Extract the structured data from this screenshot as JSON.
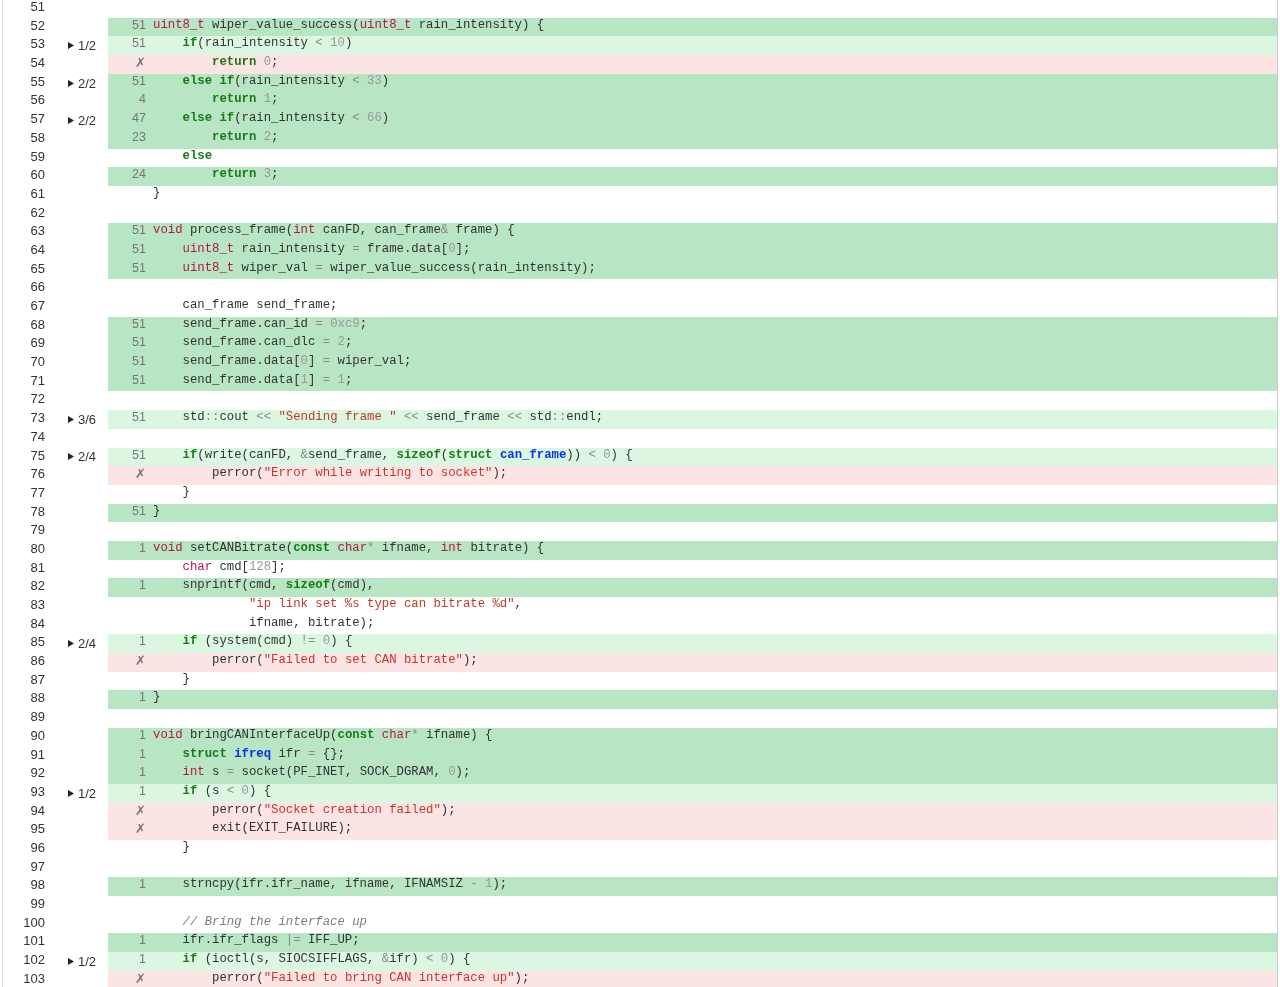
{
  "lines": [
    {
      "number": "51",
      "kind": "none"
    },
    {
      "number": "52",
      "kind": "covered",
      "count": "51",
      "code": [
        {
          "kind": "type",
          "text": "uint8_t"
        },
        {
          "kind": "plain",
          "text": " wiper_value_success("
        },
        {
          "kind": "type",
          "text": "uint8_t"
        },
        {
          "kind": "plain",
          "text": " rain_intensity) {"
        }
      ]
    },
    {
      "number": "53",
      "kind": "partial",
      "branch": "1/2",
      "count": "51",
      "code": [
        {
          "kind": "keyword",
          "text": "    if"
        },
        {
          "kind": "plain",
          "text": "(rain_intensity "
        },
        {
          "kind": "operator",
          "text": "<"
        },
        {
          "kind": "number",
          "text": " 10"
        },
        {
          "kind": "plain",
          "text": ")"
        }
      ]
    },
    {
      "number": "54",
      "kind": "uncovered",
      "count": "✗",
      "code": [
        {
          "kind": "keyword",
          "text": "        return"
        },
        {
          "kind": "number",
          "text": " 0"
        },
        {
          "kind": "plain",
          "text": ";"
        }
      ]
    },
    {
      "number": "55",
      "kind": "covered",
      "branch": "2/2",
      "count": "51",
      "code": [
        {
          "kind": "keyword",
          "text": "    else if"
        },
        {
          "kind": "plain",
          "text": "(rain_intensity "
        },
        {
          "kind": "operator",
          "text": "<"
        },
        {
          "kind": "number",
          "text": " 33"
        },
        {
          "kind": "plain",
          "text": ")"
        }
      ]
    },
    {
      "number": "56",
      "kind": "covered",
      "count": "4",
      "code": [
        {
          "kind": "keyword",
          "text": "        return"
        },
        {
          "kind": "number",
          "text": " 1"
        },
        {
          "kind": "plain",
          "text": ";"
        }
      ]
    },
    {
      "number": "57",
      "kind": "covered",
      "branch": "2/2",
      "count": "47",
      "code": [
        {
          "kind": "keyword",
          "text": "    else if"
        },
        {
          "kind": "plain",
          "text": "(rain_intensity "
        },
        {
          "kind": "operator",
          "text": "<"
        },
        {
          "kind": "number",
          "text": " 66"
        },
        {
          "kind": "plain",
          "text": ")"
        }
      ]
    },
    {
      "number": "58",
      "kind": "covered",
      "count": "23",
      "code": [
        {
          "kind": "keyword",
          "text": "        return"
        },
        {
          "kind": "number",
          "text": " 2"
        },
        {
          "kind": "plain",
          "text": ";"
        }
      ]
    },
    {
      "number": "59",
      "kind": "none",
      "code": [
        {
          "kind": "keyword",
          "text": "    else"
        }
      ]
    },
    {
      "number": "60",
      "kind": "covered",
      "count": "24",
      "code": [
        {
          "kind": "keyword",
          "text": "        return"
        },
        {
          "kind": "number",
          "text": " 3"
        },
        {
          "kind": "plain",
          "text": ";"
        }
      ]
    },
    {
      "number": "61",
      "kind": "none",
      "code": [
        {
          "kind": "plain",
          "text": "}"
        }
      ]
    },
    {
      "number": "62",
      "kind": "none"
    },
    {
      "number": "63",
      "kind": "covered",
      "count": "51",
      "code": [
        {
          "kind": "type",
          "text": "void"
        },
        {
          "kind": "plain",
          "text": " process_frame("
        },
        {
          "kind": "type",
          "text": "int"
        },
        {
          "kind": "plain",
          "text": " canFD, can_frame"
        },
        {
          "kind": "operator",
          "text": "&"
        },
        {
          "kind": "plain",
          "text": " frame) {"
        }
      ]
    },
    {
      "number": "64",
      "kind": "covered",
      "count": "51",
      "code": [
        {
          "kind": "type",
          "text": "    uint8_t"
        },
        {
          "kind": "plain",
          "text": " rain_intensity "
        },
        {
          "kind": "operator",
          "text": "="
        },
        {
          "kind": "plain",
          "text": " frame.data["
        },
        {
          "kind": "number",
          "text": "0"
        },
        {
          "kind": "plain",
          "text": "];"
        }
      ]
    },
    {
      "number": "65",
      "kind": "covered",
      "count": "51",
      "code": [
        {
          "kind": "type",
          "text": "    uint8_t"
        },
        {
          "kind": "plain",
          "text": " wiper_val "
        },
        {
          "kind": "operator",
          "text": "="
        },
        {
          "kind": "plain",
          "text": " wiper_value_success(rain_intensity);"
        }
      ]
    },
    {
      "number": "66",
      "kind": "none"
    },
    {
      "number": "67",
      "kind": "none",
      "code": [
        {
          "kind": "plain",
          "text": "    can_frame send_frame;"
        }
      ]
    },
    {
      "number": "68",
      "kind": "covered",
      "count": "51",
      "code": [
        {
          "kind": "plain",
          "text": "    send_frame.can_id "
        },
        {
          "kind": "operator",
          "text": "="
        },
        {
          "kind": "number",
          "text": " 0xc9"
        },
        {
          "kind": "plain",
          "text": ";"
        }
      ]
    },
    {
      "number": "69",
      "kind": "covered",
      "count": "51",
      "code": [
        {
          "kind": "plain",
          "text": "    send_frame.can_dlc "
        },
        {
          "kind": "operator",
          "text": "="
        },
        {
          "kind": "number",
          "text": " 2"
        },
        {
          "kind": "plain",
          "text": ";"
        }
      ]
    },
    {
      "number": "70",
      "kind": "covered",
      "count": "51",
      "code": [
        {
          "kind": "plain",
          "text": "    send_frame.data["
        },
        {
          "kind": "number",
          "text": "0"
        },
        {
          "kind": "plain",
          "text": "] "
        },
        {
          "kind": "operator",
          "text": "="
        },
        {
          "kind": "plain",
          "text": " wiper_val;"
        }
      ]
    },
    {
      "number": "71",
      "kind": "covered",
      "count": "51",
      "code": [
        {
          "kind": "plain",
          "text": "    send_frame.data["
        },
        {
          "kind": "number",
          "text": "1"
        },
        {
          "kind": "plain",
          "text": "] "
        },
        {
          "kind": "operator",
          "text": "="
        },
        {
          "kind": "number",
          "text": " 1"
        },
        {
          "kind": "plain",
          "text": ";"
        }
      ]
    },
    {
      "number": "72",
      "kind": "none"
    },
    {
      "number": "73",
      "kind": "partial",
      "branch": "3/6",
      "count": "51",
      "code": [
        {
          "kind": "plain",
          "text": "    std"
        },
        {
          "kind": "operator",
          "text": "::"
        },
        {
          "kind": "plain",
          "text": "cout "
        },
        {
          "kind": "operator",
          "text": "<<"
        },
        {
          "kind": "string",
          "text": " \"Sending frame \""
        },
        {
          "kind": "operator",
          "text": " <<"
        },
        {
          "kind": "plain",
          "text": " send_frame "
        },
        {
          "kind": "operator",
          "text": "<<"
        },
        {
          "kind": "plain",
          "text": " std"
        },
        {
          "kind": "operator",
          "text": "::"
        },
        {
          "kind": "plain",
          "text": "endl;"
        }
      ]
    },
    {
      "number": "74",
      "kind": "none"
    },
    {
      "number": "75",
      "kind": "partial",
      "branch": "2/4",
      "count": "51",
      "code": [
        {
          "kind": "keyword",
          "text": "    if"
        },
        {
          "kind": "plain",
          "text": "(write(canFD, "
        },
        {
          "kind": "operator",
          "text": "&"
        },
        {
          "kind": "plain",
          "text": "send_frame, "
        },
        {
          "kind": "keyword",
          "text": "sizeof"
        },
        {
          "kind": "plain",
          "text": "("
        },
        {
          "kind": "keyword",
          "text": "struct"
        },
        {
          "kind": "name",
          "text": " can_frame"
        },
        {
          "kind": "plain",
          "text": ")) "
        },
        {
          "kind": "operator",
          "text": "<"
        },
        {
          "kind": "number",
          "text": " 0"
        },
        {
          "kind": "plain",
          "text": ") {"
        }
      ]
    },
    {
      "number": "76",
      "kind": "uncovered",
      "count": "✗",
      "code": [
        {
          "kind": "plain",
          "text": "        perror("
        },
        {
          "kind": "string",
          "text": "\"Error while writing to socket\""
        },
        {
          "kind": "plain",
          "text": ");"
        }
      ]
    },
    {
      "number": "77",
      "kind": "none",
      "code": [
        {
          "kind": "plain",
          "text": "    }"
        }
      ]
    },
    {
      "number": "78",
      "kind": "covered",
      "count": "51",
      "code": [
        {
          "kind": "plain",
          "text": "}"
        }
      ]
    },
    {
      "number": "79",
      "kind": "none"
    },
    {
      "number": "80",
      "kind": "covered",
      "count": "1",
      "code": [
        {
          "kind": "type",
          "text": "void"
        },
        {
          "kind": "plain",
          "text": " setCANBitrate("
        },
        {
          "kind": "keyword",
          "text": "const"
        },
        {
          "kind": "type",
          "text": " char"
        },
        {
          "kind": "operator",
          "text": "*"
        },
        {
          "kind": "plain",
          "text": " ifname, "
        },
        {
          "kind": "type",
          "text": "int"
        },
        {
          "kind": "plain",
          "text": " bitrate) {"
        }
      ]
    },
    {
      "number": "81",
      "kind": "none",
      "code": [
        {
          "kind": "type",
          "text": "    char"
        },
        {
          "kind": "plain",
          "text": " cmd["
        },
        {
          "kind": "number",
          "text": "128"
        },
        {
          "kind": "plain",
          "text": "];"
        }
      ]
    },
    {
      "number": "82",
      "kind": "covered",
      "count": "1",
      "code": [
        {
          "kind": "plain",
          "text": "    snprintf(cmd, "
        },
        {
          "kind": "keyword",
          "text": "sizeof"
        },
        {
          "kind": "plain",
          "text": "(cmd),"
        }
      ]
    },
    {
      "number": "83",
      "kind": "none",
      "code": [
        {
          "kind": "string",
          "text": "             \"ip link set %s type can bitrate %d\""
        },
        {
          "kind": "plain",
          "text": ","
        }
      ]
    },
    {
      "number": "84",
      "kind": "none",
      "code": [
        {
          "kind": "plain",
          "text": "             ifname, bitrate);"
        }
      ]
    },
    {
      "number": "85",
      "kind": "partial",
      "branch": "2/4",
      "count": "1",
      "code": [
        {
          "kind": "keyword",
          "text": "    if"
        },
        {
          "kind": "plain",
          "text": " (system(cmd) "
        },
        {
          "kind": "operator",
          "text": "!="
        },
        {
          "kind": "number",
          "text": " 0"
        },
        {
          "kind": "plain",
          "text": ") {"
        }
      ]
    },
    {
      "number": "86",
      "kind": "uncovered",
      "count": "✗",
      "code": [
        {
          "kind": "plain",
          "text": "        perror("
        },
        {
          "kind": "string",
          "text": "\"Failed to set CAN bitrate\""
        },
        {
          "kind": "plain",
          "text": ");"
        }
      ]
    },
    {
      "number": "87",
      "kind": "none",
      "code": [
        {
          "kind": "plain",
          "text": "    }"
        }
      ]
    },
    {
      "number": "88",
      "kind": "covered",
      "count": "1",
      "code": [
        {
          "kind": "plain",
          "text": "}"
        }
      ]
    },
    {
      "number": "89",
      "kind": "none"
    },
    {
      "number": "90",
      "kind": "covered",
      "count": "1",
      "code": [
        {
          "kind": "type",
          "text": "void"
        },
        {
          "kind": "plain",
          "text": " bringCANInterfaceUp("
        },
        {
          "kind": "keyword",
          "text": "const"
        },
        {
          "kind": "type",
          "text": " char"
        },
        {
          "kind": "operator",
          "text": "*"
        },
        {
          "kind": "plain",
          "text": " ifname) {"
        }
      ]
    },
    {
      "number": "91",
      "kind": "covered",
      "count": "1",
      "code": [
        {
          "kind": "keyword",
          "text": "    struct"
        },
        {
          "kind": "name",
          "text": " ifreq"
        },
        {
          "kind": "plain",
          "text": " ifr "
        },
        {
          "kind": "operator",
          "text": "="
        },
        {
          "kind": "plain",
          "text": " {};"
        }
      ]
    },
    {
      "number": "92",
      "kind": "covered",
      "count": "1",
      "code": [
        {
          "kind": "type",
          "text": "    int"
        },
        {
          "kind": "plain",
          "text": " s "
        },
        {
          "kind": "operator",
          "text": "="
        },
        {
          "kind": "plain",
          "text": " socket(PF_INET, SOCK_DGRAM, "
        },
        {
          "kind": "number",
          "text": "0"
        },
        {
          "kind": "plain",
          "text": ");"
        }
      ]
    },
    {
      "number": "93",
      "kind": "partial",
      "branch": "1/2",
      "count": "1",
      "code": [
        {
          "kind": "keyword",
          "text": "    if"
        },
        {
          "kind": "plain",
          "text": " (s "
        },
        {
          "kind": "operator",
          "text": "<"
        },
        {
          "kind": "number",
          "text": " 0"
        },
        {
          "kind": "plain",
          "text": ") {"
        }
      ]
    },
    {
      "number": "94",
      "kind": "uncovered",
      "count": "✗",
      "code": [
        {
          "kind": "plain",
          "text": "        perror("
        },
        {
          "kind": "string",
          "text": "\"Socket creation failed\""
        },
        {
          "kind": "plain",
          "text": ");"
        }
      ]
    },
    {
      "number": "95",
      "kind": "uncovered",
      "count": "✗",
      "code": [
        {
          "kind": "plain",
          "text": "        exit(EXIT_FAILURE);"
        }
      ]
    },
    {
      "number": "96",
      "kind": "none",
      "code": [
        {
          "kind": "plain",
          "text": "    }"
        }
      ]
    },
    {
      "number": "97",
      "kind": "none"
    },
    {
      "number": "98",
      "kind": "covered",
      "count": "1",
      "code": [
        {
          "kind": "plain",
          "text": "    strncpy(ifr.ifr_name, ifname, IFNAMSIZ "
        },
        {
          "kind": "operator",
          "text": "-"
        },
        {
          "kind": "number",
          "text": " 1"
        },
        {
          "kind": "plain",
          "text": ");"
        }
      ]
    },
    {
      "number": "99",
      "kind": "none"
    },
    {
      "number": "100",
      "kind": "none",
      "code": [
        {
          "kind": "comment",
          "text": "    // Bring the interface up"
        }
      ]
    },
    {
      "number": "101",
      "kind": "covered",
      "count": "1",
      "code": [
        {
          "kind": "plain",
          "text": "    ifr.ifr_flags "
        },
        {
          "kind": "operator",
          "text": "|="
        },
        {
          "kind": "plain",
          "text": " IFF_UP;"
        }
      ]
    },
    {
      "number": "102",
      "kind": "partial",
      "branch": "1/2",
      "count": "1",
      "code": [
        {
          "kind": "keyword",
          "text": "    if"
        },
        {
          "kind": "plain",
          "text": " (ioctl(s, SIOCSIFFLAGS, "
        },
        {
          "kind": "operator",
          "text": "&"
        },
        {
          "kind": "plain",
          "text": "ifr) "
        },
        {
          "kind": "operator",
          "text": "<"
        },
        {
          "kind": "number",
          "text": " 0"
        },
        {
          "kind": "plain",
          "text": ") {"
        }
      ]
    },
    {
      "number": "103",
      "kind": "uncovered",
      "count": "✗",
      "code": [
        {
          "kind": "plain",
          "text": "        perror("
        },
        {
          "kind": "string",
          "text": "\"Failed to bring CAN interface up\""
        },
        {
          "kind": "plain",
          "text": ");"
        }
      ]
    }
  ]
}
